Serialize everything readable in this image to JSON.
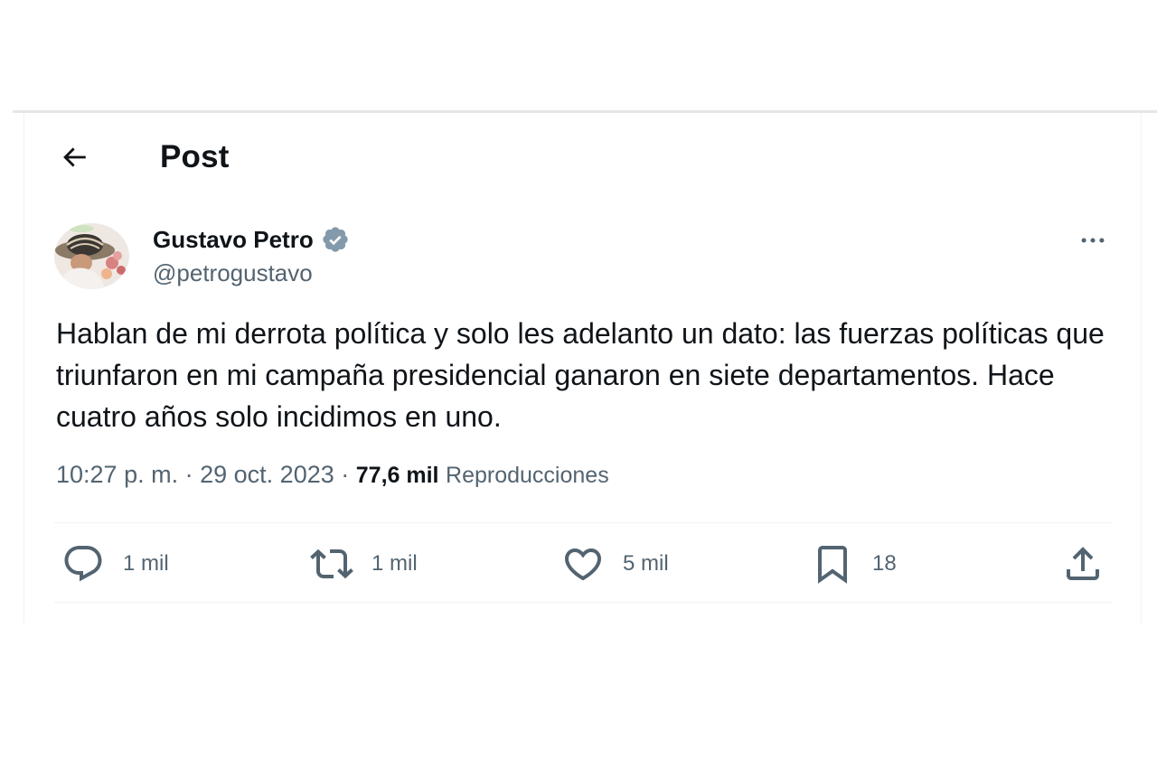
{
  "header": {
    "title": "Post",
    "back_icon": "arrow-left-icon"
  },
  "author": {
    "name": "Gustavo Petro",
    "handle": "@petrogustavo",
    "verified_icon": "verified-badge-icon",
    "verified_color": "#829aab"
  },
  "more_icon": "more-horizontal-icon",
  "tweet": {
    "text": "Hablan de mi derrota política y solo les adelanto un dato: las fuerzas políticas que triunfaron en mi campaña presidencial ganaron en siete departamentos. Hace cuatro años solo incidimos en uno."
  },
  "meta": {
    "time": "10:27 p. m.",
    "separator": "·",
    "date": "29 oct. 2023",
    "views_count": "77,6 mil",
    "views_label": "Reproducciones"
  },
  "actions": {
    "reply": {
      "icon": "reply-icon",
      "count": "1 mil"
    },
    "repost": {
      "icon": "repost-icon",
      "count": "1 mil"
    },
    "like": {
      "icon": "heart-icon",
      "count": "5 mil"
    },
    "bookmark": {
      "icon": "bookmark-icon",
      "count": "18"
    },
    "share": {
      "icon": "share-icon"
    }
  },
  "colors": {
    "text_primary": "#0f1419",
    "text_secondary": "#536471",
    "divider": "#eff3f4"
  }
}
